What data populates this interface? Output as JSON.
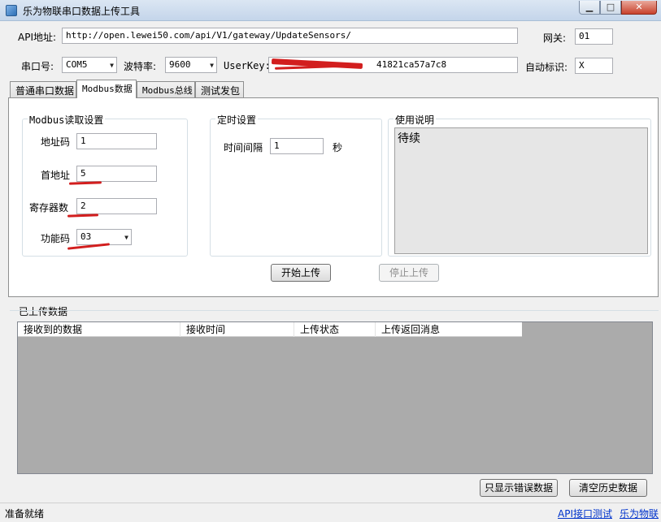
{
  "window": {
    "title": "乐为物联串口数据上传工具",
    "minimize": "▁",
    "maximize": "□",
    "close": "✕"
  },
  "form": {
    "api_label": "API地址:",
    "api_value": "http://open.lewei50.com/api/V1/gateway/UpdateSensors/",
    "gateway_label": "网关:",
    "gateway_value": "01",
    "port_label": "串口号:",
    "port_value": "COM5",
    "baud_label": "波特率:",
    "baud_value": "9600",
    "userkey_label": "UserKey:",
    "userkey_value": "41821ca57a7c8",
    "autoid_label": "自动标识:",
    "autoid_value": "X"
  },
  "tabs": [
    {
      "label": "普通串口数据"
    },
    {
      "label": "Modbus数据"
    },
    {
      "label": "Modbus总线"
    },
    {
      "label": "测试发包"
    }
  ],
  "modbus": {
    "group_title": "Modbus读取设置",
    "address_label": "地址码",
    "address_value": "1",
    "start_label": "首地址",
    "start_value": "5",
    "count_label": "寄存器数",
    "count_value": "2",
    "func_label": "功能码",
    "func_value": "03"
  },
  "timer": {
    "group_title": "定时设置",
    "interval_label": "时间间隔",
    "interval_value": "1",
    "unit": "秒"
  },
  "usage": {
    "group_title": "使用说明",
    "text": "待续"
  },
  "buttons": {
    "start": "开始上传",
    "stop": "停止上传",
    "show_errors": "只显示错误数据",
    "clear": "清空历史数据"
  },
  "uploaded": {
    "section_title": "已上传数据",
    "columns": [
      "接收到的数据",
      "接收时间",
      "上传状态",
      "上传返回消息"
    ]
  },
  "status": {
    "ready": "准备就绪",
    "api_test_link": "API接口测试",
    "brand_link": "乐为物联"
  },
  "colors": {
    "annotation_red": "#d21e1e",
    "grid_bg": "#ababab",
    "link": "#0033cc"
  }
}
